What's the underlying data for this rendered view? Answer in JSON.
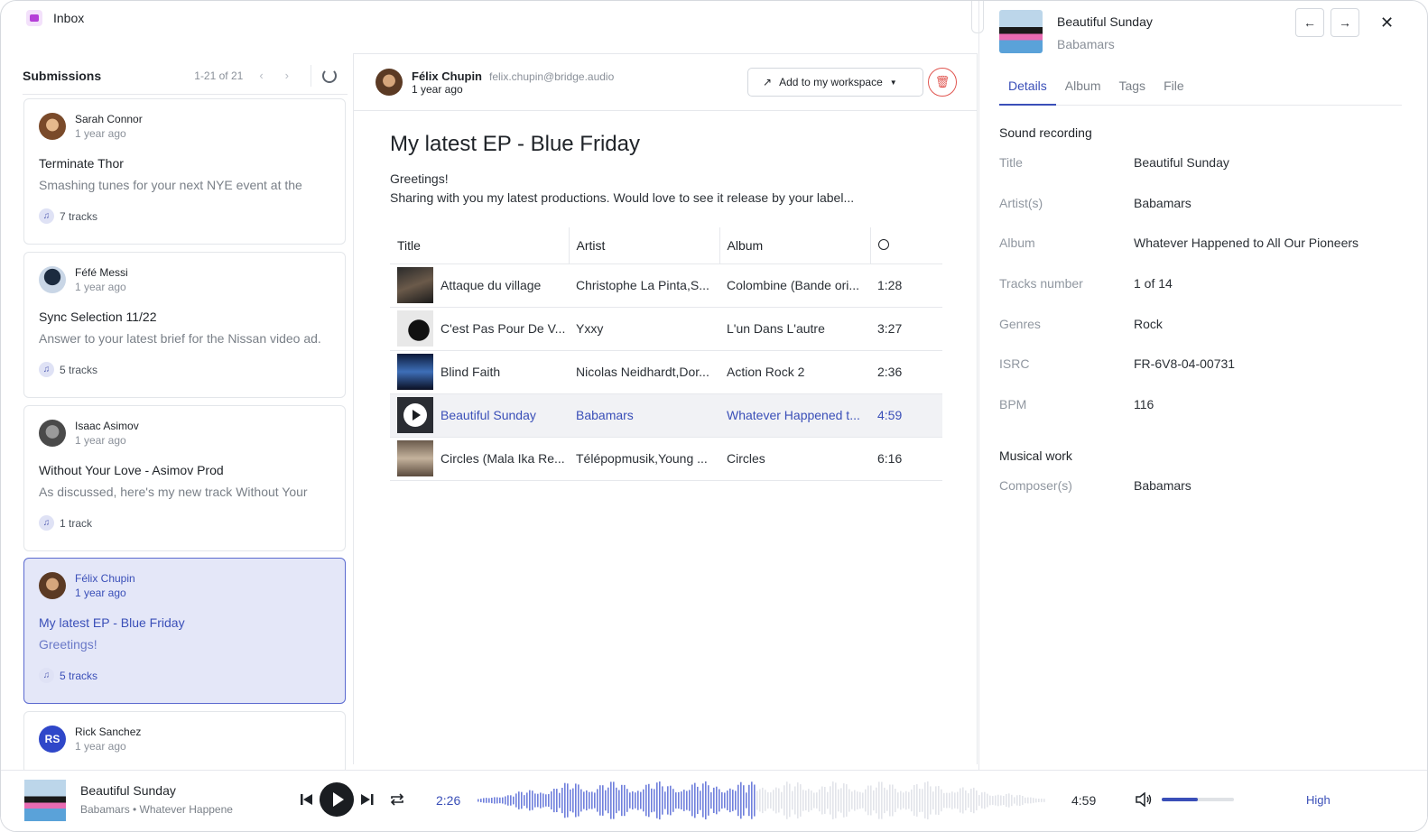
{
  "app": {
    "title": "Inbox"
  },
  "submissions": {
    "label": "Submissions",
    "count": "1-21 of 21",
    "prev_icon": "chevron-left-icon",
    "next_icon": "chevron-right-icon",
    "refresh_icon": "refresh-icon",
    "items": [
      {
        "name": "Sarah Connor",
        "ago": "1 year ago",
        "subject": "Terminate Thor",
        "preview": "Smashing tunes for your next NYE event at the",
        "tracks": "7 tracks"
      },
      {
        "name": "Féfé Messi",
        "ago": "1 year ago",
        "subject": "Sync Selection 11/22",
        "preview": "Answer to your latest brief for the Nissan video ad.",
        "tracks": "5 tracks"
      },
      {
        "name": "Isaac Asimov",
        "ago": "1 year ago",
        "subject": "Without Your Love - Asimov Prod",
        "preview": "As discussed, here's my new track Without Your",
        "tracks": "1 track"
      },
      {
        "name": "Félix Chupin",
        "ago": "1 year ago",
        "subject": "My latest EP - Blue Friday",
        "preview": "Greetings!",
        "tracks": "5 tracks"
      },
      {
        "name": "Rick Sanchez",
        "ago": "1 year ago",
        "initials": "RS"
      }
    ]
  },
  "message": {
    "sender_name": "Félix Chupin",
    "sender_email": "felix.chupin@bridge.audio",
    "ago": "1 year ago",
    "workspace_button": "Add to my workspace",
    "subject": "My latest EP - Blue Friday",
    "body_line1": "Greetings!",
    "body_line2": "Sharing with you my latest productions. Would love to see it release by your label...",
    "columns": [
      "Title",
      "Artist",
      "Album"
    ],
    "tracks": [
      {
        "title": "Attaque du village",
        "artist": "Christophe La Pinta,S...",
        "album": "Colombine (Bande ori...",
        "duration": "1:28"
      },
      {
        "title": "C'est Pas Pour De V...",
        "artist": "Yxxy",
        "album": "L'un Dans L'autre",
        "duration": "3:27"
      },
      {
        "title": "Blind Faith",
        "artist": "Nicolas Neidhardt,Dor...",
        "album": "Action Rock 2",
        "duration": "2:36"
      },
      {
        "title": "Beautiful Sunday",
        "artist": "Babamars",
        "album": "Whatever Happened t...",
        "duration": "4:59"
      },
      {
        "title": "Circles (Mala Ika Re...",
        "artist": "Télépopmusik,Young ...",
        "album": "Circles",
        "duration": "6:16"
      }
    ]
  },
  "details": {
    "title": "Beautiful Sunday",
    "artist": "Babamars",
    "tabs": [
      "Details",
      "Album",
      "Tags",
      "File"
    ],
    "sound_recording_label": "Sound recording",
    "fields": [
      {
        "k": "Title",
        "v": "Beautiful Sunday"
      },
      {
        "k": "Artist(s)",
        "v": "Babamars"
      },
      {
        "k": "Album",
        "v": "Whatever Happened to All Our Pioneers"
      },
      {
        "k": "Tracks number",
        "v": "1 of 14"
      },
      {
        "k": "Genres",
        "v": "Rock"
      },
      {
        "k": "ISRC",
        "v": "FR-6V8-04-00731"
      },
      {
        "k": "BPM",
        "v": "116"
      }
    ],
    "musical_work_label": "Musical work",
    "composer_label": "Composer(s)",
    "composer_value": "Babamars"
  },
  "player": {
    "title": "Beautiful Sunday",
    "subtitle": "Babamars  •  Whatever Happene",
    "current_time": "2:26",
    "total_time": "4:59",
    "progress": 0.49,
    "volume": 0.5,
    "quality": "High"
  },
  "colors": {
    "accent": "#3a4fb8",
    "selected_bg": "#e4e7f8",
    "danger": "#e05550"
  }
}
